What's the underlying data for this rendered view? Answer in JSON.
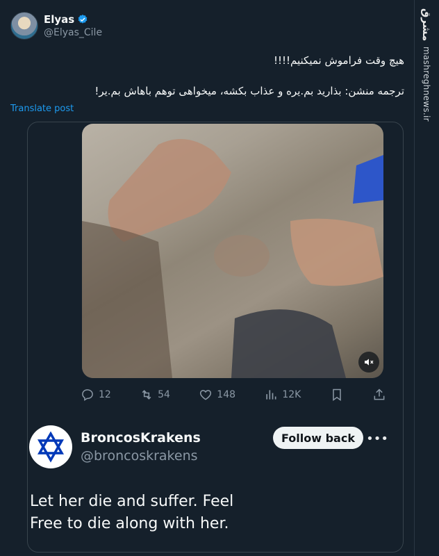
{
  "tweet": {
    "display_name": "Elyas",
    "handle": "@Elyas_Cile",
    "text_line1": "هیچ وقت فراموش نمیکنیم!!!!",
    "text_line2": "ترجمه منشن: بذارید بم.یره و عذاب بکشه، میخواهی توهم باهاش بم.یر!",
    "translate_label": "Translate post"
  },
  "quoted": {
    "stats": {
      "replies": "12",
      "reposts": "54",
      "likes": "148",
      "views": "12K"
    },
    "author": {
      "display_name": "BroncosKrakens",
      "handle": "@broncoskrakens",
      "follow_label": "Follow back",
      "more_label": "•••"
    },
    "text_line1": "Let her die and suffer. Feel",
    "text_line2": "Free to die along with her."
  },
  "watermark": {
    "logo": "مشرق",
    "url": "mashreghnews.ir"
  },
  "colors": {
    "background": "#15202b",
    "accent": "#1d9bf0",
    "muted": "#8b98a5"
  },
  "icons": [
    "verified-badge-icon",
    "mute-icon",
    "reply-icon",
    "repost-icon",
    "like-icon",
    "views-icon",
    "bookmark-icon",
    "share-icon",
    "star-of-david-icon",
    "more-icon"
  ]
}
